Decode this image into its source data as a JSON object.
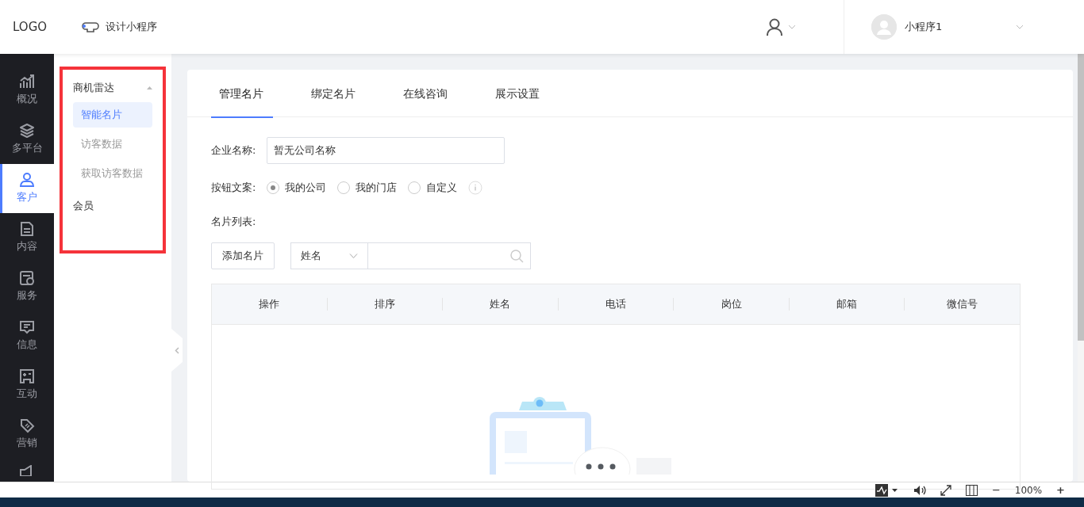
{
  "header": {
    "logo": "LOGO",
    "design_link": "设计小程序",
    "account_name": "小程序1"
  },
  "rail": [
    {
      "label": "概况",
      "selected": false
    },
    {
      "label": "多平台",
      "selected": false
    },
    {
      "label": "客户",
      "selected": true
    },
    {
      "label": "内容",
      "selected": false
    },
    {
      "label": "服务",
      "selected": false
    },
    {
      "label": "信息",
      "selected": false
    },
    {
      "label": "互动",
      "selected": false
    },
    {
      "label": "营销",
      "selected": false
    }
  ],
  "submenu": [
    {
      "label": "商机雷达",
      "expanded": true,
      "children": [
        {
          "label": "智能名片",
          "selected": true
        },
        {
          "label": "访客数据",
          "selected": false
        },
        {
          "label": "获取访客数据",
          "selected": false
        }
      ]
    },
    {
      "label": "会员"
    }
  ],
  "tabs": [
    {
      "label": "管理名片",
      "selected": true
    },
    {
      "label": "绑定名片",
      "selected": false
    },
    {
      "label": "在线咨询",
      "selected": false
    },
    {
      "label": "展示设置",
      "selected": false
    }
  ],
  "form": {
    "company": {
      "label": "企业名称:",
      "value": "暂无公司名称"
    },
    "button_text": {
      "label": "按钮文案:",
      "options": [
        {
          "label": "我的公司",
          "selected": true
        },
        {
          "label": "我的门店",
          "selected": false
        },
        {
          "label": "自定义",
          "selected": false
        }
      ]
    },
    "card_list": {
      "label": "名片列表:"
    },
    "add_button": "添加名片",
    "search_filter": "姓名"
  },
  "table": {
    "columns": [
      "操作",
      "排序",
      "姓名",
      "电话",
      "岗位",
      "邮箱",
      "微信号"
    ]
  },
  "status_bar": {
    "minus": "−",
    "zoom": "100%",
    "plus": "+"
  }
}
